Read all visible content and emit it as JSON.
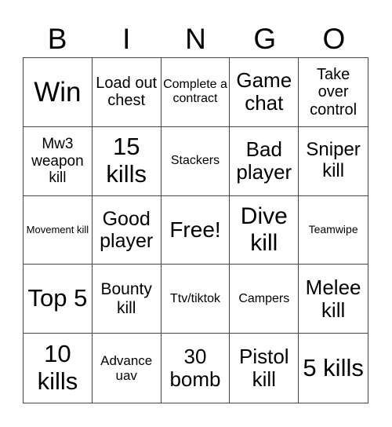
{
  "header": [
    "B",
    "I",
    "N",
    "G",
    "O"
  ],
  "cells": [
    {
      "text": "Win",
      "size": "xl"
    },
    {
      "text": "Load out chest",
      "size": "m"
    },
    {
      "text": "Complete a contract",
      "size": "s"
    },
    {
      "text": "Game chat",
      "size": "l"
    },
    {
      "text": "Take over control",
      "size": "m"
    },
    {
      "text": "Mw3 weapon kill",
      "size": "m"
    },
    {
      "text": "15 kills",
      "size": "xl"
    },
    {
      "text": "Stackers",
      "size": "s"
    },
    {
      "text": "Bad player",
      "size": "l"
    },
    {
      "text": "Sniper kill",
      "size": "l"
    },
    {
      "text": "Movement kill",
      "size": "xs"
    },
    {
      "text": "Good player",
      "size": "l"
    },
    {
      "text": "Free!",
      "size": "l"
    },
    {
      "text": "Dive kill",
      "size": "xl"
    },
    {
      "text": "Teamwipe",
      "size": "xs"
    },
    {
      "text": "Top 5",
      "size": "xl"
    },
    {
      "text": "Bounty kill",
      "size": "m"
    },
    {
      "text": "Ttv/tiktok",
      "size": "s"
    },
    {
      "text": "Campers",
      "size": "s"
    },
    {
      "text": "Melee kill",
      "size": "l"
    },
    {
      "text": "10 kills",
      "size": "xl"
    },
    {
      "text": "Advance uav",
      "size": "s"
    },
    {
      "text": "30 bomb",
      "size": "l"
    },
    {
      "text": "Pistol kill",
      "size": "l"
    },
    {
      "text": "5 kills",
      "size": "xl"
    }
  ]
}
